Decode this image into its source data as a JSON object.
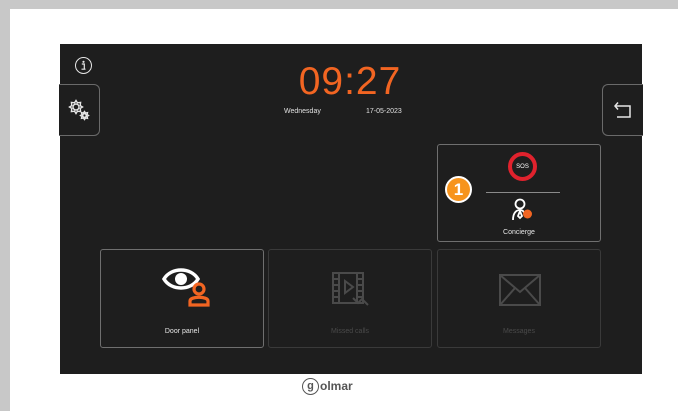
{
  "clock": {
    "time": "09:27",
    "weekday": "Wednesday",
    "date": "17-05-2023"
  },
  "icons": {
    "info": "info-icon",
    "settings": "gear-icon",
    "back": "back-arrow-icon",
    "concierge": "concierge-icon",
    "door_panel": "eye-person-icon",
    "missed_calls": "film-missed-icon",
    "messages": "envelope-icon"
  },
  "cards": {
    "sos": {
      "label": "SOS",
      "concierge_label": "Concierge",
      "callout": "1"
    },
    "door_panel": {
      "label": "Door panel"
    },
    "missed_calls": {
      "label": "Missed calls"
    },
    "messages": {
      "label": "Messages"
    }
  },
  "brand": {
    "letter": "g",
    "name": "olmar"
  },
  "colors": {
    "accent_orange": "#f26522",
    "sos_red": "#e0222d",
    "callout_orange": "#f7941d",
    "screen_bg": "#1e1e1e",
    "disabled": "#3a3a3a"
  }
}
